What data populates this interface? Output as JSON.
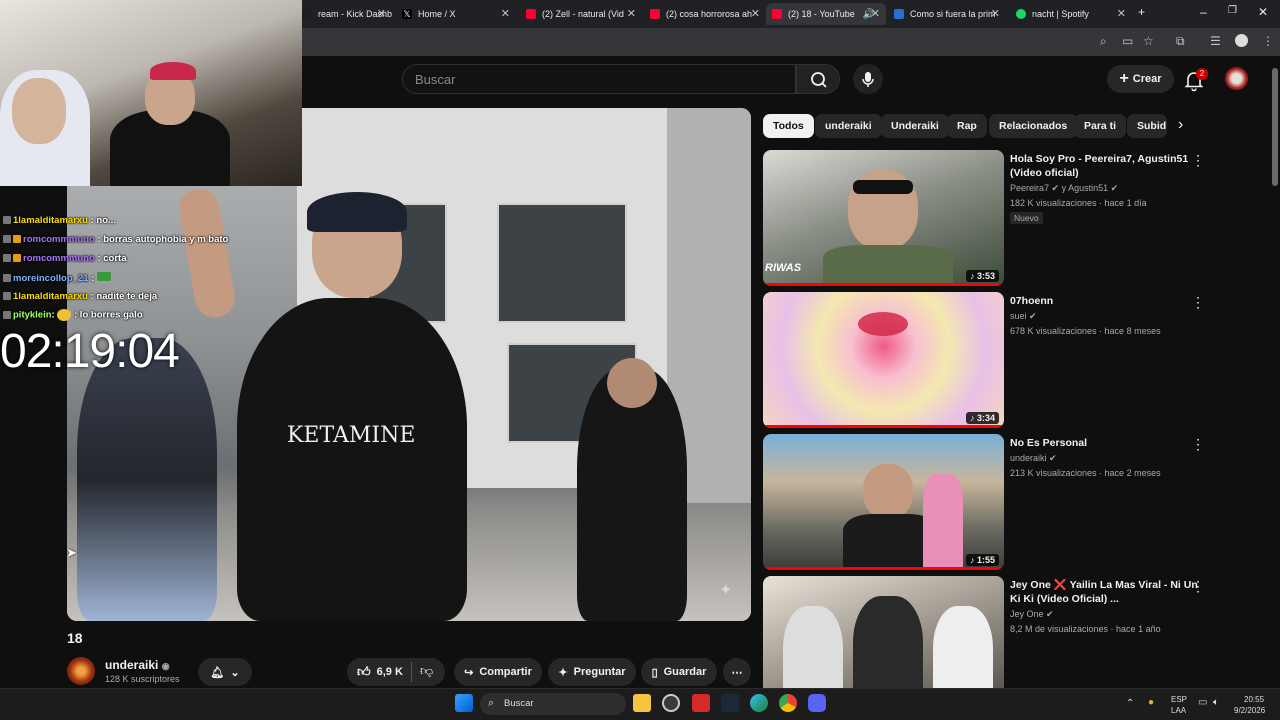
{
  "browser": {
    "tabs": [
      {
        "title": "ream - Kick Dashbo",
        "color": "#1e1e1e"
      },
      {
        "title": "Home / X",
        "color": "#000000"
      },
      {
        "title": "(2) Zell - natural (Vid",
        "color": "#ff0033"
      },
      {
        "title": "(2) cosa horrorosa ah",
        "color": "#ff0033"
      },
      {
        "title": "(2) 18 - YouTube",
        "color": "#ff0033"
      },
      {
        "title": "Como si fuera la prim",
        "color": "#2a6fd6"
      },
      {
        "title": "nacht | Spotify",
        "color": "#1ed760"
      }
    ],
    "new_tab": "+",
    "minimize": "–",
    "maximize": "❐",
    "close": "✕"
  },
  "youtube": {
    "search_placeholder": "Buscar",
    "create_label": "Crear",
    "notification_count": "2"
  },
  "chat": [
    {
      "user": "1lamalditamarxu",
      "user_color": "#ffdd00",
      "msg": ": no..."
    },
    {
      "user": "romcommmuno",
      "user_color": "#a970ff",
      "msg": ": borras autophobia y m bato"
    },
    {
      "user": "romcommmuno",
      "user_color": "#a970ff",
      "msg": ": corta"
    },
    {
      "user": "moreincollop_21",
      "user_color": "#7fb2ff",
      "msg": ":"
    },
    {
      "user": "1lamalditamarxu",
      "user_color": "#ffdd00",
      "msg": ": nadite te deja"
    },
    {
      "user": "pityklein",
      "user_color": "#a7ff60",
      "msg": ": lo borres galo"
    }
  ],
  "timer": "02:19:04",
  "video": {
    "title": "18",
    "channel": "underaiki",
    "subscribers": "128 K suscriptores",
    "likes": "6,9 K",
    "share_label": "Compartir",
    "ask_label": "Preguntar",
    "save_label": "Guardar",
    "more": "⋯"
  },
  "chips": [
    "Todos",
    "underaiki",
    "Underaiki",
    "Rap",
    "Relacionados",
    "Para ti",
    "Subid"
  ],
  "recommendations": [
    {
      "title": "Hola Soy Pro - Peereira7, Agustin51 (Video oficial)",
      "channel": "Peereira7 ✔ y Agustin51 ✔",
      "meta": "182 K visualizaciones · hace 1 día",
      "badge": "Nuevo",
      "duration": "♪ 3:53",
      "thumb_text": "RIWAS"
    },
    {
      "title": "07hoenn",
      "channel": "suei ✔",
      "meta": "678 K visualizaciones · hace 8 meses",
      "duration": "♪ 3:34"
    },
    {
      "title": "No Es Personal",
      "channel": "underaiki ✔",
      "meta": "213 K visualizaciones · hace 2 meses",
      "duration": "♪ 1:55"
    },
    {
      "title": "Jey One ❌ Yailin La Mas Viral - Ni Un Ki Ki (Video Oficial) ...",
      "channel": "Jey One ✔",
      "meta": "8,2 M de visualizaciones · hace 1 año",
      "duration": ""
    }
  ],
  "taskbar": {
    "search_label": "Buscar",
    "lang_top": "ESP",
    "lang_bottom": "LAA",
    "time": "20:55",
    "date": "9/2/2026"
  }
}
